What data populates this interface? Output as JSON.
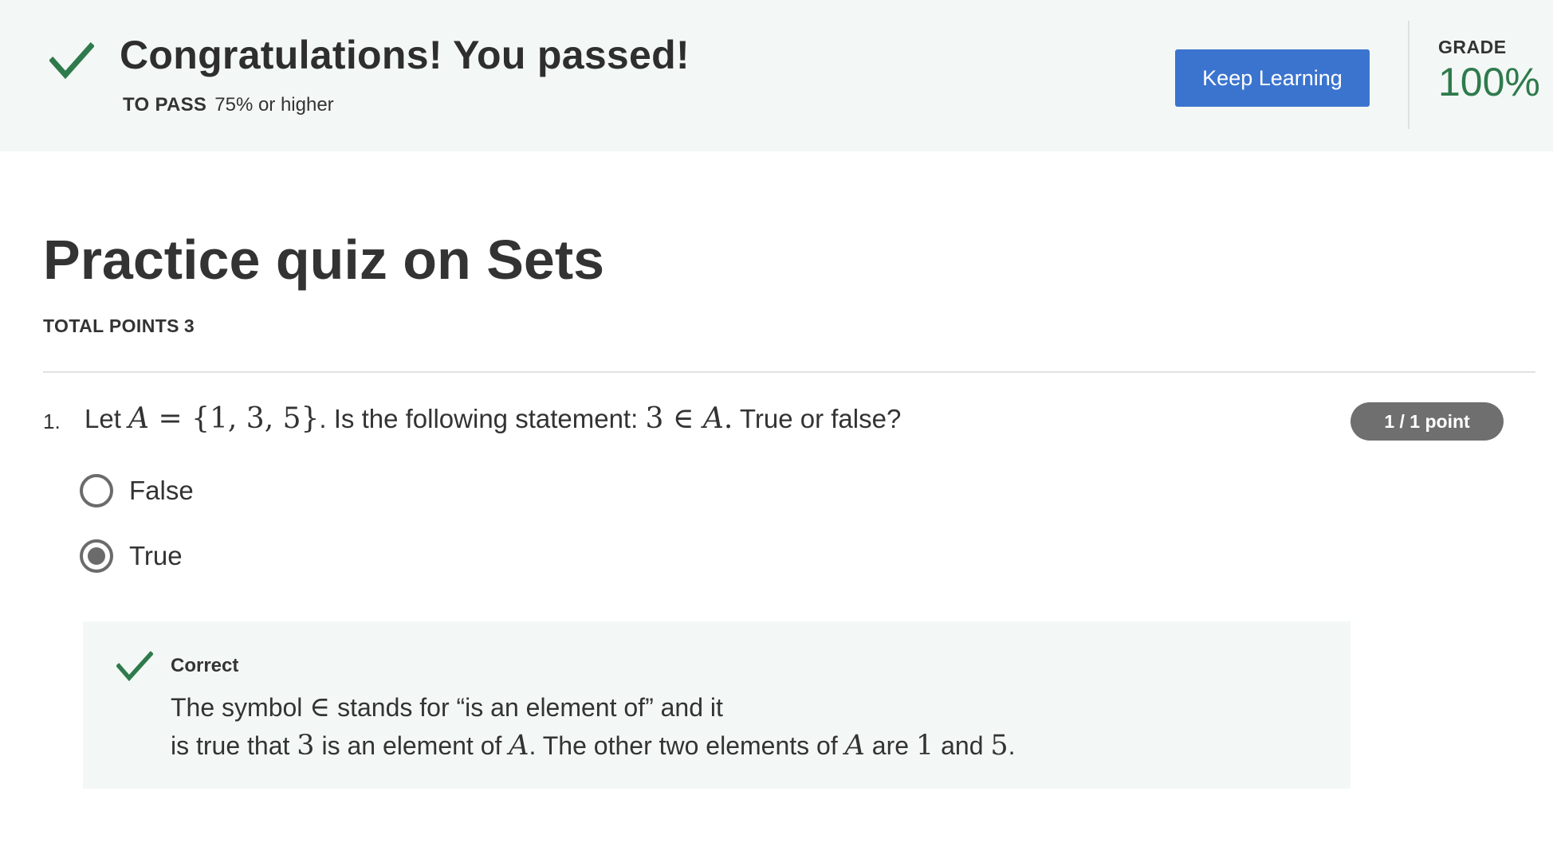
{
  "banner": {
    "title": "Congratulations! You passed!",
    "to_pass_label": "TO PASS",
    "to_pass_value": "75% or higher",
    "keep_learning_label": "Keep Learning",
    "grade_label": "GRADE",
    "grade_value": "100%",
    "check_icon": "check-icon",
    "accent_color": "#2f7a4c",
    "button_color": "#3b74cf"
  },
  "quiz": {
    "title": "Practice quiz on Sets",
    "total_points_label": "TOTAL POINTS",
    "total_points_value": "3"
  },
  "question": {
    "number": "1.",
    "text_prefix": "Let ",
    "set_var": "A",
    "set_eq": " = {1, 3, 5}",
    "text_middle": ". Is the following statement:  ",
    "stmt_num": "3 ∈ ",
    "stmt_var": "A",
    "stmt_dot": ".",
    "text_suffix": "  True or false?",
    "points": "1 / 1 point",
    "options": [
      {
        "label": "False",
        "selected": false
      },
      {
        "label": "True",
        "selected": true
      }
    ]
  },
  "feedback": {
    "status": "Correct",
    "line1_a": "The symbol ",
    "line1_sym": "∈",
    "line1_b": " stands for “is an element of” and it",
    "line2_a": "is true that ",
    "line2_n": "3",
    "line2_b": " is an element of ",
    "line2_var1": "A",
    "line2_c": ". The other two elements of ",
    "line2_var2": "A",
    "line2_d": " are ",
    "line2_n1": "1",
    "line2_e": " and ",
    "line2_n2": "5",
    "line2_f": ".",
    "check_icon": "check-icon"
  }
}
